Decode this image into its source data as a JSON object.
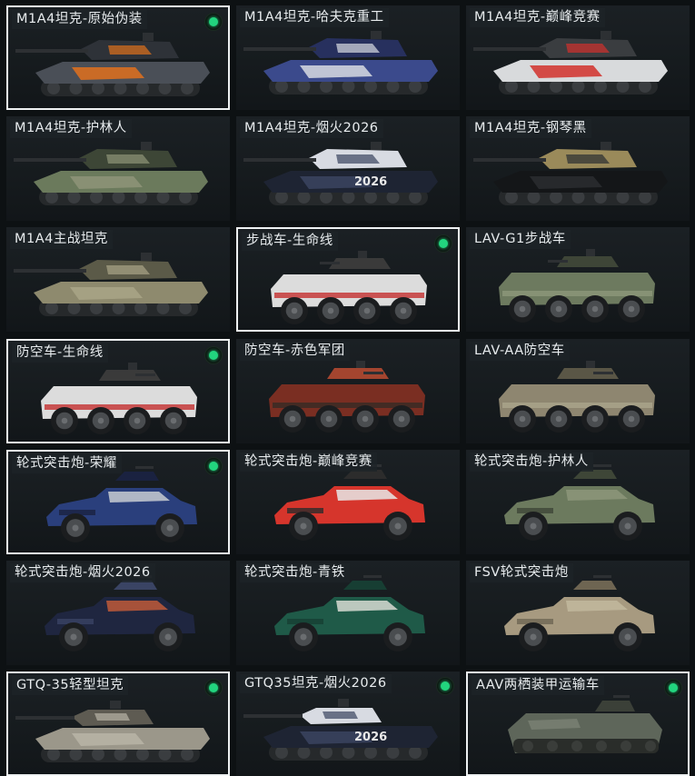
{
  "cards": [
    {
      "name": "M1A4坦克-原始伪装",
      "type": "tank",
      "selected": true,
      "equipped": true,
      "colors": [
        "#4a4f57",
        "#e0701d",
        "#2e3238"
      ]
    },
    {
      "name": "M1A4坦克-哈夫克重工",
      "type": "tank",
      "selected": false,
      "equipped": false,
      "colors": [
        "#3b4a8c",
        "#d8dbe2",
        "#27305e"
      ]
    },
    {
      "name": "M1A4坦克-巅峰竞赛",
      "type": "tank",
      "selected": false,
      "equipped": false,
      "colors": [
        "#d8dadc",
        "#d2302c",
        "#3a3d40"
      ]
    },
    {
      "name": "M1A4坦克-护林人",
      "type": "tank",
      "selected": false,
      "equipped": false,
      "colors": [
        "#6b7a5c",
        "#8e9478",
        "#3d4636"
      ]
    },
    {
      "name": "M1A4坦克-烟火2026",
      "type": "tank2026",
      "selected": false,
      "equipped": false,
      "colors": [
        "#1e2433",
        "#3b4460",
        "#d8dbe2"
      ]
    },
    {
      "name": "M1A4坦克-钢琴黑",
      "type": "tank",
      "selected": false,
      "equipped": false,
      "colors": [
        "#141618",
        "#2a2d30",
        "#9a8a5a"
      ]
    },
    {
      "name": "M1A4主战坦克",
      "type": "tank",
      "selected": false,
      "equipped": false,
      "colors": [
        "#8e8a6e",
        "#a9a487",
        "#5b5a48"
      ]
    },
    {
      "name": "步战车-生命线",
      "type": "ifv",
      "selected": true,
      "equipped": true,
      "colors": [
        "#dcdcdc",
        "#c53a3a",
        "#3a3a3a"
      ]
    },
    {
      "name": "LAV-G1步战车",
      "type": "ifv",
      "selected": false,
      "equipped": false,
      "colors": [
        "#6d7a5f",
        "#8c9779",
        "#3e4537"
      ]
    },
    {
      "name": "防空车-生命线",
      "type": "aa",
      "selected": true,
      "equipped": true,
      "colors": [
        "#dcdcdc",
        "#c53a3a",
        "#3a3a3a"
      ]
    },
    {
      "name": "防空车-赤色军团",
      "type": "aa",
      "selected": false,
      "equipped": false,
      "colors": [
        "#7a2e22",
        "#3a2a24",
        "#a4452f"
      ]
    },
    {
      "name": "LAV-AA防空车",
      "type": "aa",
      "selected": false,
      "equipped": false,
      "colors": [
        "#8e8670",
        "#a9a389",
        "#5a5646"
      ]
    },
    {
      "name": "轮式突击炮-荣耀",
      "type": "suv",
      "selected": true,
      "equipped": true,
      "colors": [
        "#2a3f7c",
        "#c8ccd2",
        "#1a2240"
      ]
    },
    {
      "name": "轮式突击炮-巅峰竞赛",
      "type": "suv",
      "selected": false,
      "equipped": false,
      "colors": [
        "#d6352c",
        "#e8e8e8",
        "#2c2c2c"
      ]
    },
    {
      "name": "轮式突击炮-护林人",
      "type": "suv",
      "selected": false,
      "equipped": false,
      "colors": [
        "#6c7a5e",
        "#8d977a",
        "#3e4637"
      ]
    },
    {
      "name": "轮式突击炮-烟火2026",
      "type": "suv",
      "selected": false,
      "equipped": false,
      "colors": [
        "#1f2640",
        "#c05a3a",
        "#3a4464"
      ]
    },
    {
      "name": "轮式突击炮-青铁",
      "type": "suv",
      "selected": false,
      "equipped": false,
      "colors": [
        "#1f5a48",
        "#d8dcd4",
        "#173e33"
      ]
    },
    {
      "name": "FSV轮式突击炮",
      "type": "suv",
      "selected": false,
      "equipped": false,
      "colors": [
        "#a79a80",
        "#c2b89e",
        "#6e6552"
      ]
    },
    {
      "name": "GTQ-35轻型坦克",
      "type": "light",
      "selected": true,
      "equipped": true,
      "colors": [
        "#9b978a",
        "#b8b4a6",
        "#5e5b52"
      ]
    },
    {
      "name": "GTQ35坦克-烟火2026",
      "type": "light2026",
      "selected": false,
      "equipped": true,
      "colors": [
        "#1e2433",
        "#3b4460",
        "#d8dbe2"
      ]
    },
    {
      "name": "AAV两栖装甲运输车",
      "type": "aav",
      "selected": true,
      "equipped": true,
      "colors": [
        "#5e665a",
        "#7a8274",
        "#3b4038"
      ]
    }
  ]
}
